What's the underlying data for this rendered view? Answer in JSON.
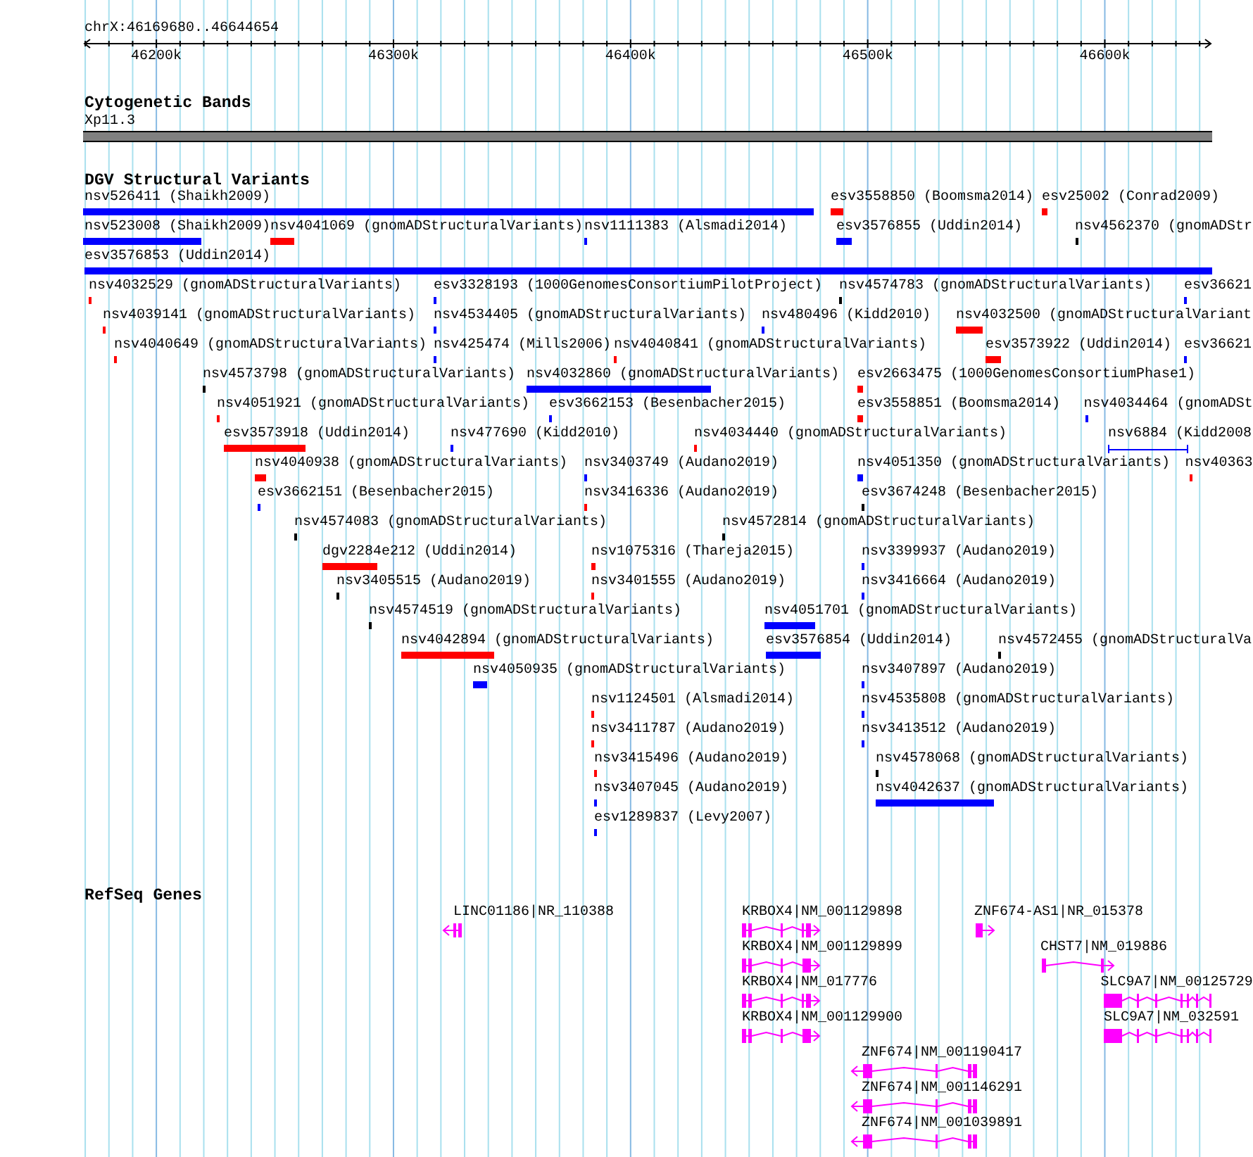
{
  "ruler": {
    "location": "chrX:46169680..46644654",
    "ticks": [
      "46200k",
      "46300k",
      "46400k",
      "46500k",
      "46600k"
    ]
  },
  "tracks": [
    {
      "kind": "cytoband",
      "title": "Cytogenetic Bands",
      "band": "Xp11.3"
    },
    {
      "kind": "variants",
      "title": "DGV Structural Variants",
      "features": [
        {
          "label": "nsv526411 (Shaikh2009)",
          "color": "#0000ff",
          "kind": "box"
        },
        {
          "label": "esv3558850 (Boomsma2014)",
          "color": "#ff0000",
          "kind": "box"
        },
        {
          "label": "esv25002 (Conrad2009)",
          "color": "#ff0000",
          "kind": "box"
        },
        {
          "label": "nsv523008 (Shaikh2009)",
          "color": "#0000ff",
          "kind": "box"
        },
        {
          "label": "nsv4041069 (gnomADStructuralVariants)",
          "color": "#ff0000",
          "kind": "box"
        },
        {
          "label": "nsv1111383 (Alsmadi2014)",
          "color": "#0000ff",
          "kind": "box"
        },
        {
          "label": "esv3576855 (Uddin2014)",
          "color": "#0000ff",
          "kind": "box"
        },
        {
          "label": "nsv4562370 (gnomADStr",
          "color": "#000000",
          "kind": "box"
        },
        {
          "label": "esv3576853 (Uddin2014)",
          "color": "#0000ff",
          "kind": "box"
        },
        {
          "label": "nsv4032529 (gnomADStructuralVariants)",
          "color": "#ff0000",
          "kind": "box"
        },
        {
          "label": "esv3328193 (1000GenomesConsortiumPilotProject)",
          "color": "#0000ff",
          "kind": "box"
        },
        {
          "label": "nsv4574783 (gnomADStructuralVariants)",
          "color": "#000000",
          "kind": "box"
        },
        {
          "label": "esv36621",
          "color": "#0000ff",
          "kind": "box"
        },
        {
          "label": "nsv4039141 (gnomADStructuralVariants)",
          "color": "#ff0000",
          "kind": "box"
        },
        {
          "label": "nsv4534405 (gnomADStructuralVariants)",
          "color": "#0000ff",
          "kind": "box"
        },
        {
          "label": "nsv480496 (Kidd2010)",
          "color": "#0000ff",
          "kind": "box"
        },
        {
          "label": "nsv4032500 (gnomADStructuralVariant",
          "color": "#ff0000",
          "kind": "box"
        },
        {
          "label": "nsv4040649 (gnomADStructuralVariants)",
          "color": "#ff0000",
          "kind": "box"
        },
        {
          "label": "nsv425474 (Mills2006)",
          "color": "#0000ff",
          "kind": "box"
        },
        {
          "label": "nsv4040841 (gnomADStructuralVariants)",
          "color": "#ff0000",
          "kind": "box"
        },
        {
          "label": "esv3573922 (Uddin2014)",
          "color": "#ff0000",
          "kind": "box"
        },
        {
          "label": "esv36621",
          "color": "#0000ff",
          "kind": "box"
        },
        {
          "label": "nsv4573798 (gnomADStructuralVariants)",
          "color": "#000000",
          "kind": "box"
        },
        {
          "label": "nsv4032860 (gnomADStructuralVariants)",
          "color": "#0000ff",
          "kind": "box"
        },
        {
          "label": "esv2663475 (1000GenomesConsortiumPhase1)",
          "color": "#ff0000",
          "kind": "box"
        },
        {
          "label": "nsv4051921 (gnomADStructuralVariants)",
          "color": "#ff0000",
          "kind": "box"
        },
        {
          "label": "esv3662153 (Besenbacher2015)",
          "color": "#0000ff",
          "kind": "box"
        },
        {
          "label": "esv3558851 (Boomsma2014)",
          "color": "#ff0000",
          "kind": "box"
        },
        {
          "label": "nsv4034464 (gnomADSt",
          "color": "#0000ff",
          "kind": "box"
        },
        {
          "label": "esv3573918 (Uddin2014)",
          "color": "#ff0000",
          "kind": "box"
        },
        {
          "label": "nsv477690 (Kidd2010)",
          "color": "#0000ff",
          "kind": "box"
        },
        {
          "label": "nsv4034440 (gnomADStructuralVariants)",
          "color": "#ff0000",
          "kind": "box"
        },
        {
          "label": "nsv6884 (Kidd2008",
          "color": "#0000ff",
          "kind": "line"
        },
        {
          "label": "nsv4040938 (gnomADStructuralVariants)",
          "color": "#ff0000",
          "kind": "box"
        },
        {
          "label": "nsv3403749 (Audano2019)",
          "color": "#0000ff",
          "kind": "box"
        },
        {
          "label": "nsv4051350 (gnomADStructuralVariants)",
          "color": "#0000ff",
          "kind": "box"
        },
        {
          "label": "nsv40363",
          "color": "#ff0000",
          "kind": "box"
        },
        {
          "label": "esv3662151 (Besenbacher2015)",
          "color": "#0000ff",
          "kind": "box"
        },
        {
          "label": "nsv3416336 (Audano2019)",
          "color": "#ff0000",
          "kind": "box"
        },
        {
          "label": "esv3674248 (Besenbacher2015)",
          "color": "#000000",
          "kind": "box"
        },
        {
          "label": "nsv4574083 (gnomADStructuralVariants)",
          "color": "#000000",
          "kind": "box"
        },
        {
          "label": "nsv4572814 (gnomADStructuralVariants)",
          "color": "#000000",
          "kind": "box"
        },
        {
          "label": "dgv2284e212 (Uddin2014)",
          "color": "#ff0000",
          "kind": "box"
        },
        {
          "label": "nsv1075316 (Thareja2015)",
          "color": "#ff0000",
          "kind": "box"
        },
        {
          "label": "nsv3399937 (Audano2019)",
          "color": "#0000ff",
          "kind": "box"
        },
        {
          "label": "nsv3405515 (Audano2019)",
          "color": "#000000",
          "kind": "box"
        },
        {
          "label": "nsv3401555 (Audano2019)",
          "color": "#ff0000",
          "kind": "box"
        },
        {
          "label": "nsv3416664 (Audano2019)",
          "color": "#0000ff",
          "kind": "box"
        },
        {
          "label": "nsv4574519 (gnomADStructuralVariants)",
          "color": "#000000",
          "kind": "box"
        },
        {
          "label": "nsv4051701 (gnomADStructuralVariants)",
          "color": "#0000ff",
          "kind": "box"
        },
        {
          "label": "nsv4042894 (gnomADStructuralVariants)",
          "color": "#ff0000",
          "kind": "box"
        },
        {
          "label": "esv3576854 (Uddin2014)",
          "color": "#0000ff",
          "kind": "box"
        },
        {
          "label": "nsv4572455 (gnomADStructuralVa",
          "color": "#000000",
          "kind": "box"
        },
        {
          "label": "nsv4050935 (gnomADStructuralVariants)",
          "color": "#0000ff",
          "kind": "box"
        },
        {
          "label": "nsv3407897 (Audano2019)",
          "color": "#0000ff",
          "kind": "box"
        },
        {
          "label": "nsv1124501 (Alsmadi2014)",
          "color": "#ff0000",
          "kind": "box"
        },
        {
          "label": "nsv4535808 (gnomADStructuralVariants)",
          "color": "#0000ff",
          "kind": "box"
        },
        {
          "label": "nsv3411787 (Audano2019)",
          "color": "#ff0000",
          "kind": "box"
        },
        {
          "label": "nsv3413512 (Audano2019)",
          "color": "#0000ff",
          "kind": "box"
        },
        {
          "label": "nsv3415496 (Audano2019)",
          "color": "#ff0000",
          "kind": "box"
        },
        {
          "label": "nsv4578068 (gnomADStructuralVariants)",
          "color": "#000000",
          "kind": "box"
        },
        {
          "label": "nsv3407045 (Audano2019)",
          "color": "#0000ff",
          "kind": "box"
        },
        {
          "label": "nsv4042637 (gnomADStructuralVariants)",
          "color": "#0000ff",
          "kind": "box"
        },
        {
          "label": "esv1289837 (Levy2007)",
          "color": "#0000ff",
          "kind": "box"
        }
      ]
    },
    {
      "kind": "genes",
      "title": "RefSeq Genes",
      "features": [
        {
          "label": "LINC01186|NR_110388",
          "kind": "reverse"
        },
        {
          "label": "KRBOX4|NM_001129898",
          "kind": "forward"
        },
        {
          "label": "ZNF674-AS1|NR_015378",
          "kind": "forward"
        },
        {
          "label": "KRBOX4|NM_001129899",
          "kind": "forward"
        },
        {
          "label": "CHST7|NM_019886",
          "kind": "forward"
        },
        {
          "label": "KRBOX4|NM_017776",
          "kind": "forward"
        },
        {
          "label": "SLC9A7|NM_00125729",
          "kind": "clipped"
        },
        {
          "label": "KRBOX4|NM_001129900",
          "kind": "forward"
        },
        {
          "label": "SLC9A7|NM_032591",
          "kind": "clipped"
        },
        {
          "label": "ZNF674|NM_001190417",
          "kind": "reverse"
        },
        {
          "label": "ZNF674|NM_001146291",
          "kind": "reverse"
        },
        {
          "label": "ZNF674|NM_001039891",
          "kind": "reverse"
        }
      ]
    }
  ]
}
